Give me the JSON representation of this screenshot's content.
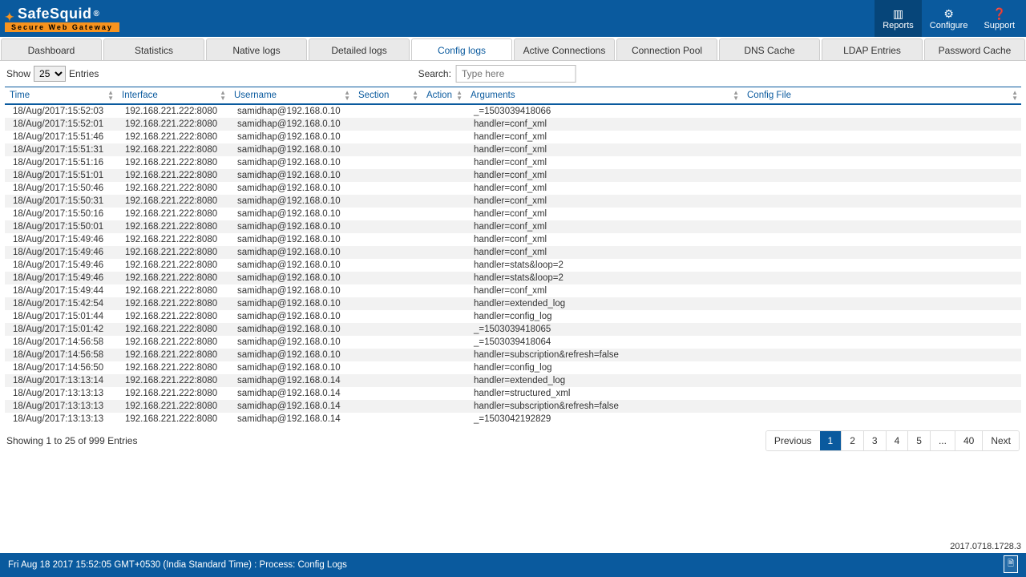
{
  "brand": {
    "name": "SafeSquid",
    "reg": "®",
    "subtitle": "Secure Web Gateway"
  },
  "topbuttons": {
    "reports": "Reports",
    "configure": "Configure",
    "support": "Support"
  },
  "tabs": {
    "dashboard": "Dashboard",
    "statistics": "Statistics",
    "nativelogs": "Native logs",
    "detailedlogs": "Detailed logs",
    "configlogs": "Config logs",
    "activeconn": "Active Connections",
    "connpool": "Connection Pool",
    "dnscache": "DNS Cache",
    "ldap": "LDAP Entries",
    "pwcache": "Password Cache"
  },
  "controls": {
    "show": "Show",
    "entries": "Entries",
    "pagesize": "25",
    "search_label": "Search:",
    "search_placeholder": "Type here"
  },
  "columns": {
    "time": "Time",
    "interface": "Interface",
    "username": "Username",
    "section": "Section",
    "action": "Action",
    "arguments": "Arguments",
    "configfile": "Config File"
  },
  "rows": [
    {
      "time": "18/Aug/2017:15:52:03",
      "iface": "192.168.221.222:8080",
      "user": "samidhap@192.168.0.10",
      "section": "",
      "action": "",
      "args": "_=1503039418066",
      "cfg": ""
    },
    {
      "time": "18/Aug/2017:15:52:01",
      "iface": "192.168.221.222:8080",
      "user": "samidhap@192.168.0.10",
      "section": "",
      "action": "",
      "args": "handler=conf_xml",
      "cfg": ""
    },
    {
      "time": "18/Aug/2017:15:51:46",
      "iface": "192.168.221.222:8080",
      "user": "samidhap@192.168.0.10",
      "section": "",
      "action": "",
      "args": "handler=conf_xml",
      "cfg": ""
    },
    {
      "time": "18/Aug/2017:15:51:31",
      "iface": "192.168.221.222:8080",
      "user": "samidhap@192.168.0.10",
      "section": "",
      "action": "",
      "args": "handler=conf_xml",
      "cfg": ""
    },
    {
      "time": "18/Aug/2017:15:51:16",
      "iface": "192.168.221.222:8080",
      "user": "samidhap@192.168.0.10",
      "section": "",
      "action": "",
      "args": "handler=conf_xml",
      "cfg": ""
    },
    {
      "time": "18/Aug/2017:15:51:01",
      "iface": "192.168.221.222:8080",
      "user": "samidhap@192.168.0.10",
      "section": "",
      "action": "",
      "args": "handler=conf_xml",
      "cfg": ""
    },
    {
      "time": "18/Aug/2017:15:50:46",
      "iface": "192.168.221.222:8080",
      "user": "samidhap@192.168.0.10",
      "section": "",
      "action": "",
      "args": "handler=conf_xml",
      "cfg": ""
    },
    {
      "time": "18/Aug/2017:15:50:31",
      "iface": "192.168.221.222:8080",
      "user": "samidhap@192.168.0.10",
      "section": "",
      "action": "",
      "args": "handler=conf_xml",
      "cfg": ""
    },
    {
      "time": "18/Aug/2017:15:50:16",
      "iface": "192.168.221.222:8080",
      "user": "samidhap@192.168.0.10",
      "section": "",
      "action": "",
      "args": "handler=conf_xml",
      "cfg": ""
    },
    {
      "time": "18/Aug/2017:15:50:01",
      "iface": "192.168.221.222:8080",
      "user": "samidhap@192.168.0.10",
      "section": "",
      "action": "",
      "args": "handler=conf_xml",
      "cfg": ""
    },
    {
      "time": "18/Aug/2017:15:49:46",
      "iface": "192.168.221.222:8080",
      "user": "samidhap@192.168.0.10",
      "section": "",
      "action": "",
      "args": "handler=conf_xml",
      "cfg": ""
    },
    {
      "time": "18/Aug/2017:15:49:46",
      "iface": "192.168.221.222:8080",
      "user": "samidhap@192.168.0.10",
      "section": "",
      "action": "",
      "args": "handler=conf_xml",
      "cfg": ""
    },
    {
      "time": "18/Aug/2017:15:49:46",
      "iface": "192.168.221.222:8080",
      "user": "samidhap@192.168.0.10",
      "section": "",
      "action": "",
      "args": "handler=stats&loop=2",
      "cfg": ""
    },
    {
      "time": "18/Aug/2017:15:49:46",
      "iface": "192.168.221.222:8080",
      "user": "samidhap@192.168.0.10",
      "section": "",
      "action": "",
      "args": "handler=stats&loop=2",
      "cfg": ""
    },
    {
      "time": "18/Aug/2017:15:49:44",
      "iface": "192.168.221.222:8080",
      "user": "samidhap@192.168.0.10",
      "section": "",
      "action": "",
      "args": "handler=conf_xml",
      "cfg": ""
    },
    {
      "time": "18/Aug/2017:15:42:54",
      "iface": "192.168.221.222:8080",
      "user": "samidhap@192.168.0.10",
      "section": "",
      "action": "",
      "args": "handler=extended_log",
      "cfg": ""
    },
    {
      "time": "18/Aug/2017:15:01:44",
      "iface": "192.168.221.222:8080",
      "user": "samidhap@192.168.0.10",
      "section": "",
      "action": "",
      "args": "handler=config_log",
      "cfg": ""
    },
    {
      "time": "18/Aug/2017:15:01:42",
      "iface": "192.168.221.222:8080",
      "user": "samidhap@192.168.0.10",
      "section": "",
      "action": "",
      "args": "_=1503039418065",
      "cfg": ""
    },
    {
      "time": "18/Aug/2017:14:56:58",
      "iface": "192.168.221.222:8080",
      "user": "samidhap@192.168.0.10",
      "section": "",
      "action": "",
      "args": "_=1503039418064",
      "cfg": ""
    },
    {
      "time": "18/Aug/2017:14:56:58",
      "iface": "192.168.221.222:8080",
      "user": "samidhap@192.168.0.10",
      "section": "",
      "action": "",
      "args": "handler=subscription&refresh=false",
      "cfg": ""
    },
    {
      "time": "18/Aug/2017:14:56:50",
      "iface": "192.168.221.222:8080",
      "user": "samidhap@192.168.0.10",
      "section": "",
      "action": "",
      "args": "handler=config_log",
      "cfg": ""
    },
    {
      "time": "18/Aug/2017:13:13:14",
      "iface": "192.168.221.222:8080",
      "user": "samidhap@192.168.0.14",
      "section": "",
      "action": "",
      "args": "handler=extended_log",
      "cfg": ""
    },
    {
      "time": "18/Aug/2017:13:13:13",
      "iface": "192.168.221.222:8080",
      "user": "samidhap@192.168.0.14",
      "section": "",
      "action": "",
      "args": "handler=structured_xml",
      "cfg": ""
    },
    {
      "time": "18/Aug/2017:13:13:13",
      "iface": "192.168.221.222:8080",
      "user": "samidhap@192.168.0.14",
      "section": "",
      "action": "",
      "args": "handler=subscription&refresh=false",
      "cfg": ""
    },
    {
      "time": "18/Aug/2017:13:13:13",
      "iface": "192.168.221.222:8080",
      "user": "samidhap@192.168.0.14",
      "section": "",
      "action": "",
      "args": "_=1503042192829",
      "cfg": ""
    }
  ],
  "footer": {
    "summary": "Showing 1 to 25 of 999 Entries",
    "prev": "Previous",
    "next": "Next",
    "pages": [
      "1",
      "2",
      "3",
      "4",
      "5",
      "...",
      "40"
    ]
  },
  "status": {
    "left": "Fri Aug 18 2017 15:52:05 GMT+0530 (India Standard Time) : Process: Config Logs"
  },
  "version": "2017.0718.1728.3"
}
